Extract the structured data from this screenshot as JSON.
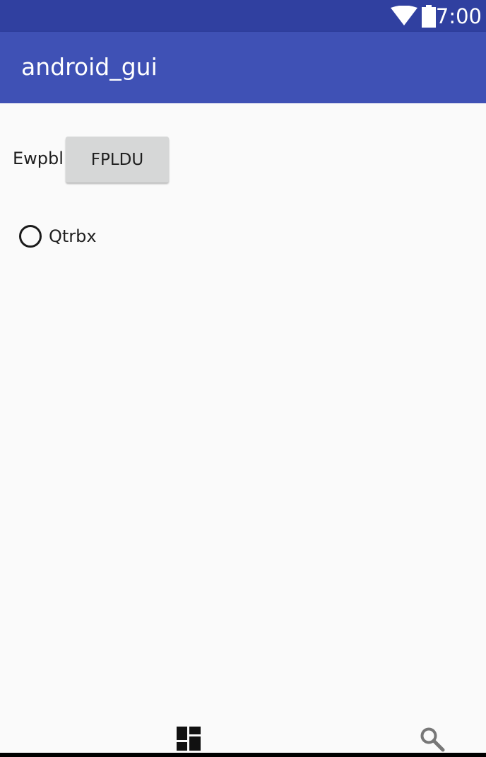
{
  "status_bar": {
    "time": "7:00",
    "icons": [
      "wifi-icon",
      "battery-icon"
    ]
  },
  "app_bar": {
    "title": "android_gui"
  },
  "main": {
    "label": "Ewpbl",
    "button_label": "FPLDU",
    "radio": {
      "label": "Qtrbx",
      "checked": false
    }
  },
  "bottom_bar": {
    "icons": [
      "dashboard-icon",
      "search-icon"
    ]
  },
  "colors": {
    "status_bar": "#3040a0",
    "app_bar": "#3f51b5",
    "background": "#fafafa",
    "button": "#d6d7d7"
  }
}
